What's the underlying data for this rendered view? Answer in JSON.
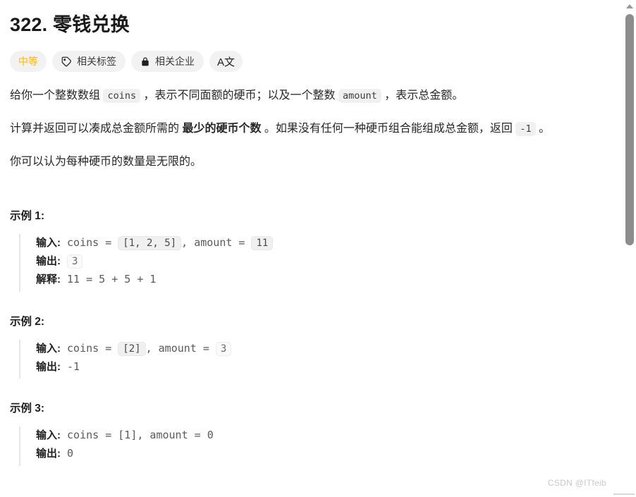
{
  "problem": {
    "number": "322.",
    "title": "零钱兑换",
    "full_title": "322. 零钱兑换"
  },
  "pills": [
    {
      "label": "中等",
      "icon": "none",
      "kind": "difficulty"
    },
    {
      "label": "相关标签",
      "icon": "tag-icon",
      "kind": "normal"
    },
    {
      "label": "相关企业",
      "icon": "lock-icon",
      "kind": "normal"
    },
    {
      "label": "A文",
      "icon": "translate-icon",
      "kind": "icon-only"
    }
  ],
  "description": {
    "p1": {
      "t1": "给你一个整数数组 ",
      "code1": "coins",
      "t2": " ，表示不同面额的硬币；以及一个整数 ",
      "code2": "amount",
      "t3": " ，表示总金额。"
    },
    "p2": {
      "t1": "计算并返回可以凑成总金额所需的 ",
      "bold": "最少的硬币个数",
      "t2": " 。如果没有任何一种硬币组合能组成总金额，返回 ",
      "code1": "-1",
      "t3": " 。"
    },
    "p3": {
      "t1": "你可以认为每种硬币的数量是无限的。"
    }
  },
  "examples": [
    {
      "heading": "示例 1:",
      "input_label": "输入:",
      "input_prefix": " coins = ",
      "input_code1": "[1, 2, 5]",
      "input_mid": ", amount = ",
      "input_code2": "11",
      "output_label": "输出:",
      "output_code": "3",
      "explain_label": "解释:",
      "explain_text": " 11 = 5 + 5 + 1"
    },
    {
      "heading": "示例 2:",
      "input_label": "输入:",
      "input_prefix": " coins = ",
      "input_code1": "[2]",
      "input_mid": ", amount = ",
      "input_code2": "3",
      "output_label": "输出:",
      "output_plain": " -1"
    },
    {
      "heading": "示例 3:",
      "input_label": "输入:",
      "input_plain": " coins = [1], amount = 0",
      "output_label": "输出:",
      "output_plain": " 0"
    }
  ],
  "watermark": "CSDN @ITfeib",
  "colors": {
    "difficulty": "#ffb800",
    "pill_bg": "#f2f2f2",
    "code_bg": "#f0f0f0",
    "text": "#262626",
    "scrollbar_thumb": "#8d8d8d"
  }
}
